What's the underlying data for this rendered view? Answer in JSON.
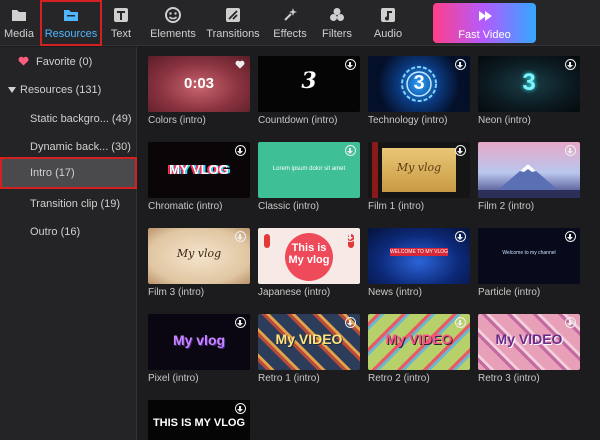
{
  "toolbar": {
    "tabs": [
      {
        "label": "Media",
        "icon": "folder-icon"
      },
      {
        "label": "Resources",
        "icon": "resources-folder-icon"
      },
      {
        "label": "Text",
        "icon": "text-icon"
      },
      {
        "label": "Elements",
        "icon": "elements-smiley-icon"
      },
      {
        "label": "Transitions",
        "icon": "transitions-icon"
      },
      {
        "label": "Effects",
        "icon": "effects-sparkle-icon"
      },
      {
        "label": "Filters",
        "icon": "filters-circles-icon"
      },
      {
        "label": "Audio",
        "icon": "music-note-icon"
      }
    ],
    "active_tab": "Resources",
    "fast_video_label": "Fast Video"
  },
  "sidebar": {
    "favorite": "Favorite (0)",
    "resources": "Resources (131)",
    "items": [
      "Static backgro... (49)",
      "Dynamic back... (30)",
      "Intro (17)",
      "Transition clip (19)",
      "Outro (16)"
    ],
    "selected": "Intro (17)"
  },
  "grid": {
    "items": [
      {
        "label": "Colors (intro)",
        "text": "0:03",
        "favorite": true
      },
      {
        "label": "Countdown (intro)",
        "text": "3"
      },
      {
        "label": "Technology (intro)",
        "text": "3"
      },
      {
        "label": "Neon (intro)",
        "text": "3"
      },
      {
        "label": "Chromatic (intro)",
        "text": "MY VLOG"
      },
      {
        "label": "Classic (intro)",
        "text": "Lorem ipsum dolor sit amet"
      },
      {
        "label": "Film 1 (intro)",
        "text": "My vlog"
      },
      {
        "label": "Film 2 (intro)",
        "text": ""
      },
      {
        "label": "Film 3 (intro)",
        "text": "My vlog"
      },
      {
        "label": "Japanese (intro)",
        "text": "This is My vlog"
      },
      {
        "label": "News (intro)",
        "text": "WELCOME TO MY VLOG"
      },
      {
        "label": "Particle (intro)",
        "text": "Welcome to my channel"
      },
      {
        "label": "Pixel (intro)",
        "text": "My vlog"
      },
      {
        "label": "Retro 1 (intro)",
        "text": "My VIDEO"
      },
      {
        "label": "Retro 2 (intro)",
        "text": "My VIDEO"
      },
      {
        "label": "Retro 3 (intro)",
        "text": "My VIDEO"
      },
      {
        "label": "",
        "text": "THIS IS MY VLOG"
      }
    ]
  }
}
